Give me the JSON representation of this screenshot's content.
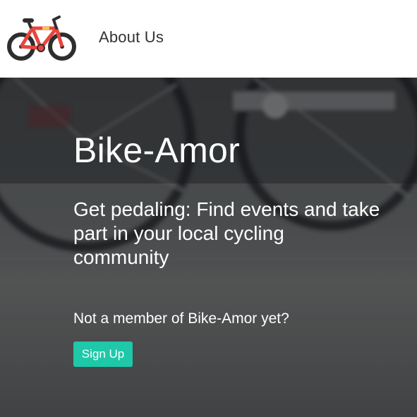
{
  "nav": {
    "logo_icon": "bicycle-icon",
    "about_label": "About Us"
  },
  "hero": {
    "title": "Bike-Amor",
    "subtitle": "Get pedaling: Find events and take part in your local cycling community",
    "question": "Not a member of Bike-Amor yet?",
    "signup_label": "Sign Up"
  },
  "colors": {
    "accent": "#1ec8a8",
    "bike_frame": "#e8453c",
    "text_dark": "#333333"
  }
}
